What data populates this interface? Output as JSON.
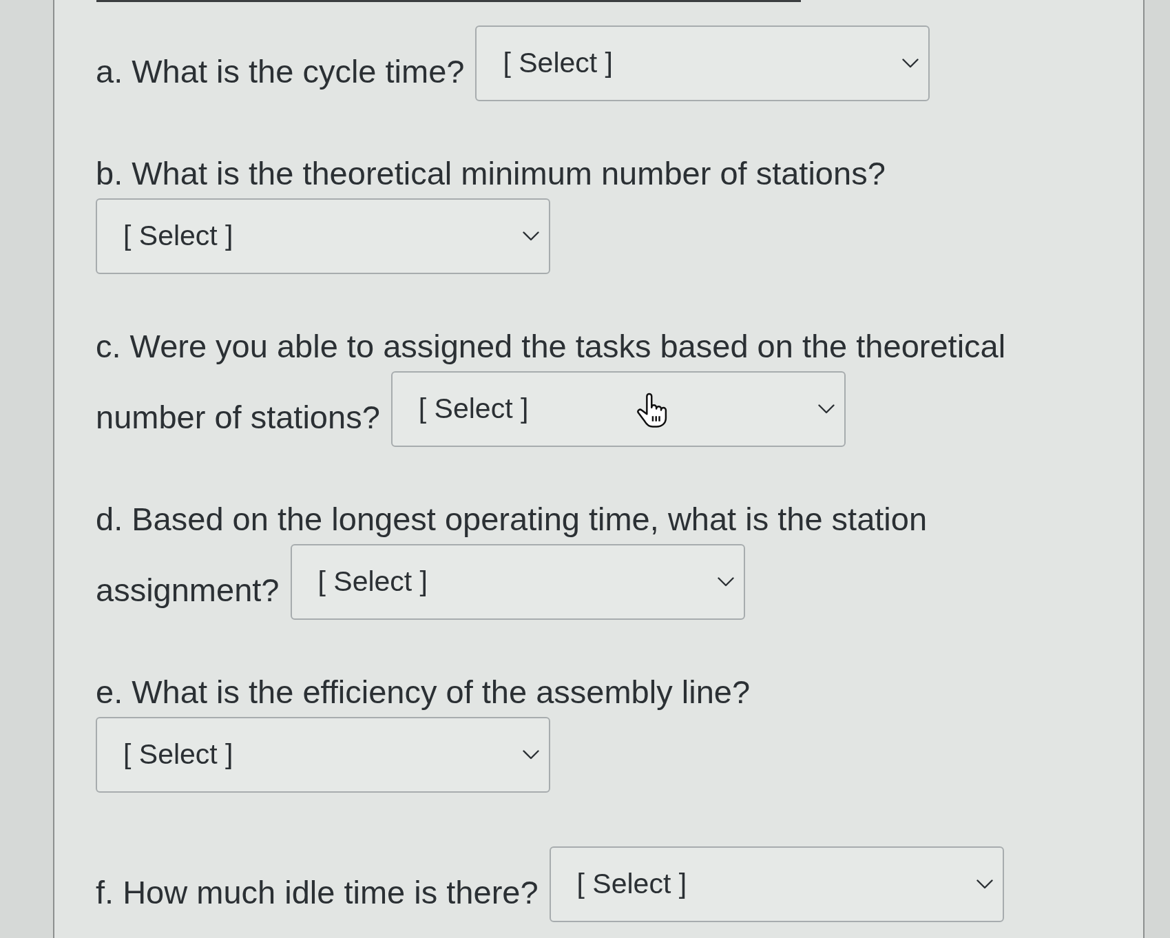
{
  "questions": [
    {
      "kind": "inline",
      "lines": [
        "a. What is the cycle time?"
      ],
      "dropdown": {
        "value": "[ Select ]",
        "cursor_over": false
      }
    },
    {
      "kind": "below",
      "lines": [
        "b. What is the theoretical minimum number of stations?"
      ],
      "dropdown": {
        "value": "[ Select ]",
        "cursor_over": false
      }
    },
    {
      "kind": "inline",
      "lines": [
        "c. Were you able to assigned the tasks based on the theoretical",
        "number of stations?"
      ],
      "dropdown": {
        "value": "[ Select ]",
        "cursor_over": true
      }
    },
    {
      "kind": "inline",
      "lines": [
        "d. Based on the longest operating time, what is the station",
        "assignment?"
      ],
      "dropdown": {
        "value": "[ Select ]",
        "cursor_over": false
      }
    },
    {
      "kind": "below",
      "lines": [
        "e. What is the efficiency of the assembly line?"
      ],
      "dropdown": {
        "value": "[ Select ]",
        "cursor_over": false
      }
    },
    {
      "kind": "inline",
      "lines": [
        "f. How much idle time is there?"
      ],
      "dropdown": {
        "value": "[ Select ]",
        "cursor_over": false
      }
    }
  ]
}
